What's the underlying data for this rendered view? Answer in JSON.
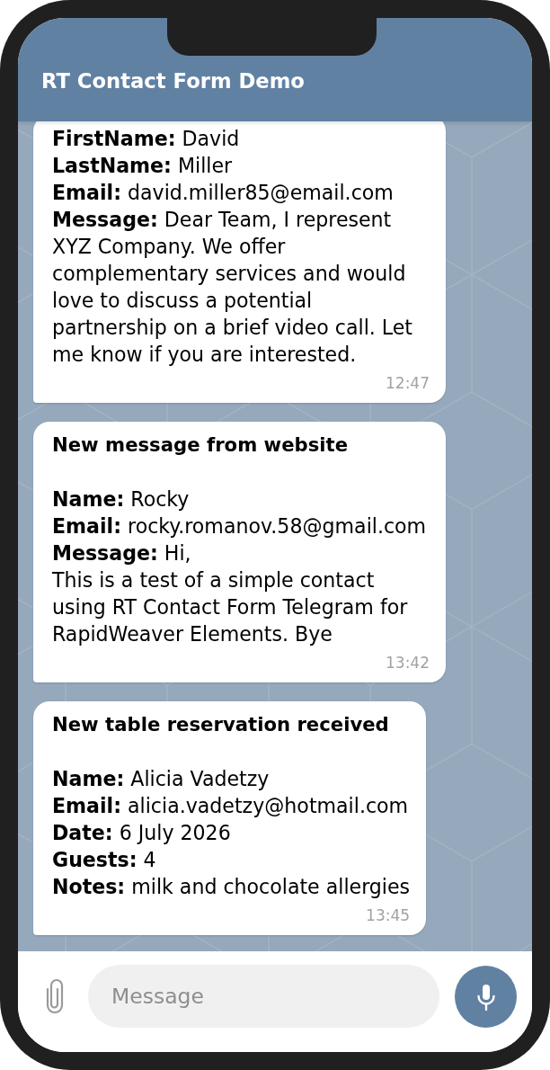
{
  "header": {
    "title": "RT Contact Form Demo"
  },
  "messages": [
    {
      "lines": [
        "**FirstName:** David",
        "**LastName:** Miller",
        "**Email:** david.miller85@email.com",
        "**Message:** Dear Team, I represent XYZ Company. We offer complementary services and would love to discuss a potential partnership on a brief video call. Let me know if you are interested."
      ],
      "time": "12:47"
    },
    {
      "title": "New message from website",
      "lines": [
        "**Name:** Rocky",
        "**Email:** rocky.romanov.58@gmail.com",
        "**Message:** Hi,\nThis is a test of a simple contact using RT Contact Form Telegram for RapidWeaver Elements. Bye"
      ],
      "time": "13:42"
    },
    {
      "title": "New table reservation received",
      "lines": [
        "**Name:** Alicia Vadetzy",
        "**Email:** alicia.vadetzy@hotmail.com",
        "**Date:** 6 July 2026",
        "**Guests:** 4",
        "**Notes:** milk and chocolate allergies"
      ],
      "time": "13:45"
    }
  ],
  "composer": {
    "placeholder": "Message"
  }
}
